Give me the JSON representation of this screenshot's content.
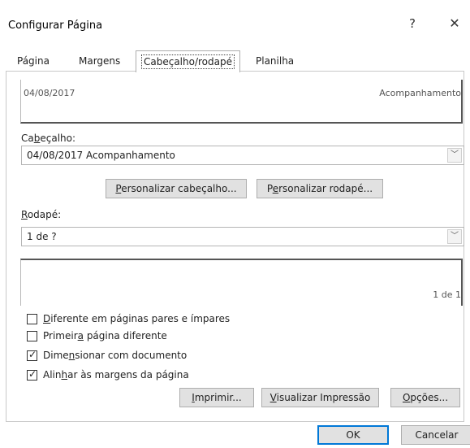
{
  "window": {
    "title": "Configurar Página",
    "help_label": "?",
    "close_label": "✕"
  },
  "tabs": [
    {
      "label": "Página"
    },
    {
      "label": "Margens"
    },
    {
      "label": "Cabeçalho/rodapé",
      "selected": true
    },
    {
      "label": "Planilha"
    }
  ],
  "header_preview": {
    "left_text": "04/08/2017",
    "right_text": "Acompanhamento"
  },
  "header": {
    "label_pre": "Ca",
    "label_u": "b",
    "label_post": "eçalho:",
    "value": "04/08/2017 Acompanhamento"
  },
  "buttons": {
    "customize_header_u": "P",
    "customize_header_rest": "ersonalizar cabeçalho...",
    "customize_footer_pre": "P",
    "customize_footer_u": "e",
    "customize_footer_rest": "rsonalizar rodapé...",
    "print_u": "I",
    "print_rest": "mprimir...",
    "preview_u": "V",
    "preview_rest": "isualizar Impressão",
    "options_u": "O",
    "options_rest": "pções...",
    "ok": "OK",
    "cancel": "Cancelar"
  },
  "footer": {
    "label_u": "R",
    "label_post": "odapé:",
    "value": "1 de ?"
  },
  "footer_preview": {
    "right_text": "1 de 1"
  },
  "checkboxes": [
    {
      "pre": "",
      "u": "D",
      "post": "iferente em páginas pares e ímpares",
      "checked": false
    },
    {
      "pre": "Primeir",
      "u": "a",
      "post": " página diferente",
      "checked": false
    },
    {
      "pre": "Dime",
      "u": "n",
      "post": "sionar com documento",
      "checked": true
    },
    {
      "pre": "Alin",
      "u": "h",
      "post": "ar às margens da página",
      "checked": true
    }
  ],
  "icons": {
    "dropdown": "chevron-down-icon",
    "check": "checkmark-icon"
  },
  "check_mark_glyph": "✓",
  "dropdown_glyph": "﹀"
}
